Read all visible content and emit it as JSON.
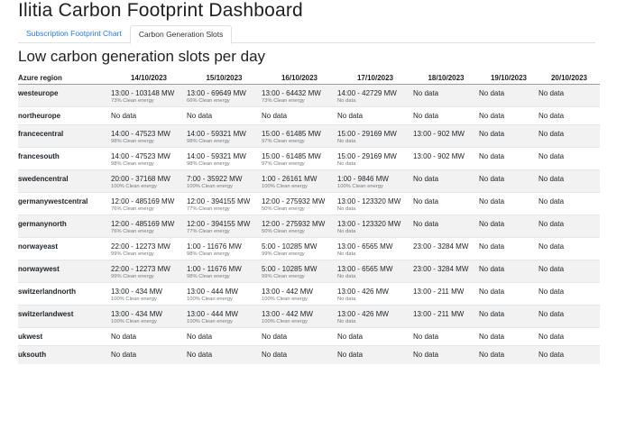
{
  "app": {
    "title": "Ilitia Carbon Footprint Dashboard"
  },
  "tabs": [
    {
      "label": "Subscription Footprint Chart",
      "active": false
    },
    {
      "label": "Carbon Generation Slots",
      "active": true
    }
  ],
  "section": {
    "title": "Low carbon generation slots per day"
  },
  "table": {
    "headers": [
      "Azure region",
      "14/10/2023",
      "15/10/2023",
      "16/10/2023",
      "17/10/2023",
      "18/10/2023",
      "19/10/2023",
      "20/10/2023"
    ],
    "rows": [
      {
        "region": "westeurope",
        "cells": [
          {
            "main": "13:00 - 103148 MW",
            "sub": "73% Clean energy"
          },
          {
            "main": "13:00 - 69649 MW",
            "sub": "66% Clean energy"
          },
          {
            "main": "13:00 - 64432 MW",
            "sub": "73% Clean energy"
          },
          {
            "main": "14:00 - 42729 MW",
            "sub": "No data"
          },
          {
            "main": "No data",
            "sub": ""
          },
          {
            "main": "No data",
            "sub": ""
          },
          {
            "main": "No data",
            "sub": ""
          }
        ]
      },
      {
        "region": "northeurope",
        "cells": [
          {
            "main": "No data",
            "sub": ""
          },
          {
            "main": "No data",
            "sub": ""
          },
          {
            "main": "No data",
            "sub": ""
          },
          {
            "main": "No data",
            "sub": ""
          },
          {
            "main": "No data",
            "sub": ""
          },
          {
            "main": "No data",
            "sub": ""
          },
          {
            "main": "No data",
            "sub": ""
          }
        ]
      },
      {
        "region": "francecentral",
        "cells": [
          {
            "main": "14:00 - 47523 MW",
            "sub": "98% Clean energy"
          },
          {
            "main": "14:00 - 59321 MW",
            "sub": "98% Clean energy"
          },
          {
            "main": "15:00 - 61485 MW",
            "sub": "97% Clean energy"
          },
          {
            "main": "15:00 - 29169 MW",
            "sub": "No data"
          },
          {
            "main": "13:00 - 902 MW",
            "sub": ""
          },
          {
            "main": "No data",
            "sub": ""
          },
          {
            "main": "No data",
            "sub": ""
          }
        ]
      },
      {
        "region": "francesouth",
        "cells": [
          {
            "main": "14:00 - 47523 MW",
            "sub": "98% Clean energy"
          },
          {
            "main": "14:00 - 59321 MW",
            "sub": "98% Clean energy"
          },
          {
            "main": "15:00 - 61485 MW",
            "sub": "97% Clean energy"
          },
          {
            "main": "15:00 - 29169 MW",
            "sub": "No data"
          },
          {
            "main": "13:00 - 902 MW",
            "sub": ""
          },
          {
            "main": "No data",
            "sub": ""
          },
          {
            "main": "No data",
            "sub": ""
          }
        ]
      },
      {
        "region": "swedencentral",
        "cells": [
          {
            "main": "20:00 - 37168 MW",
            "sub": "100% Clean energy"
          },
          {
            "main": "7:00 - 35922 MW",
            "sub": "100% Clean energy"
          },
          {
            "main": "1:00 - 26161 MW",
            "sub": "100% Clean energy"
          },
          {
            "main": "1:00 - 9846 MW",
            "sub": "100% Clean energy"
          },
          {
            "main": "No data",
            "sub": ""
          },
          {
            "main": "No data",
            "sub": ""
          },
          {
            "main": "No data",
            "sub": ""
          }
        ]
      },
      {
        "region": "germanywestcentral",
        "cells": [
          {
            "main": "12:00 - 485169 MW",
            "sub": "76% Clean energy"
          },
          {
            "main": "12:00 - 394155 MW",
            "sub": "77% Clean energy"
          },
          {
            "main": "12:00 - 275932 MW",
            "sub": "50% Clean energy"
          },
          {
            "main": "13:00 - 123320 MW",
            "sub": "No data"
          },
          {
            "main": "No data",
            "sub": ""
          },
          {
            "main": "No data",
            "sub": ""
          },
          {
            "main": "No data",
            "sub": ""
          }
        ]
      },
      {
        "region": "germanynorth",
        "cells": [
          {
            "main": "12:00 - 485169 MW",
            "sub": "76% Clean energy"
          },
          {
            "main": "12:00 - 394155 MW",
            "sub": "77% Clean energy"
          },
          {
            "main": "12:00 - 275932 MW",
            "sub": "50% Clean energy"
          },
          {
            "main": "13:00 - 123320 MW",
            "sub": "No data"
          },
          {
            "main": "No data",
            "sub": ""
          },
          {
            "main": "No data",
            "sub": ""
          },
          {
            "main": "No data",
            "sub": ""
          }
        ]
      },
      {
        "region": "norwayeast",
        "cells": [
          {
            "main": "22:00 - 12273 MW",
            "sub": "99% Clean energy"
          },
          {
            "main": "1:00 - 11676 MW",
            "sub": "98% Clean energy"
          },
          {
            "main": "5:00 - 10285 MW",
            "sub": "99% Clean energy"
          },
          {
            "main": "13:00 - 6565 MW",
            "sub": "No data"
          },
          {
            "main": "23:00 - 3284 MW",
            "sub": ""
          },
          {
            "main": "No data",
            "sub": ""
          },
          {
            "main": "No data",
            "sub": ""
          }
        ]
      },
      {
        "region": "norwaywest",
        "cells": [
          {
            "main": "22:00 - 12273 MW",
            "sub": "99% Clean energy"
          },
          {
            "main": "1:00 - 11676 MW",
            "sub": "98% Clean energy"
          },
          {
            "main": "5:00 - 10285 MW",
            "sub": "99% Clean energy"
          },
          {
            "main": "13:00 - 6565 MW",
            "sub": "No data"
          },
          {
            "main": "23:00 - 3284 MW",
            "sub": ""
          },
          {
            "main": "No data",
            "sub": ""
          },
          {
            "main": "No data",
            "sub": ""
          }
        ]
      },
      {
        "region": "switzerlandnorth",
        "cells": [
          {
            "main": "13:00 - 434 MW",
            "sub": "100% Clean energy"
          },
          {
            "main": "13:00 - 444 MW",
            "sub": "100% Clean energy"
          },
          {
            "main": "13:00 - 442 MW",
            "sub": "100% Clean energy"
          },
          {
            "main": "13:00 - 426 MW",
            "sub": "No data"
          },
          {
            "main": "13:00 - 211 MW",
            "sub": ""
          },
          {
            "main": "No data",
            "sub": ""
          },
          {
            "main": "No data",
            "sub": ""
          }
        ]
      },
      {
        "region": "switzerlandwest",
        "cells": [
          {
            "main": "13:00 - 434 MW",
            "sub": "100% Clean energy"
          },
          {
            "main": "13:00 - 444 MW",
            "sub": "100% Clean energy"
          },
          {
            "main": "13:00 - 442 MW",
            "sub": "100% Clean energy"
          },
          {
            "main": "13:00 - 426 MW",
            "sub": "No data"
          },
          {
            "main": "13:00 - 211 MW",
            "sub": ""
          },
          {
            "main": "No data",
            "sub": ""
          },
          {
            "main": "No data",
            "sub": ""
          }
        ]
      },
      {
        "region": "ukwest",
        "cells": [
          {
            "main": "No data",
            "sub": ""
          },
          {
            "main": "No data",
            "sub": ""
          },
          {
            "main": "No data",
            "sub": ""
          },
          {
            "main": "No data",
            "sub": ""
          },
          {
            "main": "No data",
            "sub": ""
          },
          {
            "main": "No data",
            "sub": ""
          },
          {
            "main": "No data",
            "sub": ""
          }
        ]
      },
      {
        "region": "uksouth",
        "cells": [
          {
            "main": "No data",
            "sub": ""
          },
          {
            "main": "No data",
            "sub": ""
          },
          {
            "main": "No data",
            "sub": ""
          },
          {
            "main": "No data",
            "sub": ""
          },
          {
            "main": "No data",
            "sub": ""
          },
          {
            "main": "No data",
            "sub": ""
          },
          {
            "main": "No data",
            "sub": ""
          }
        ]
      }
    ]
  }
}
